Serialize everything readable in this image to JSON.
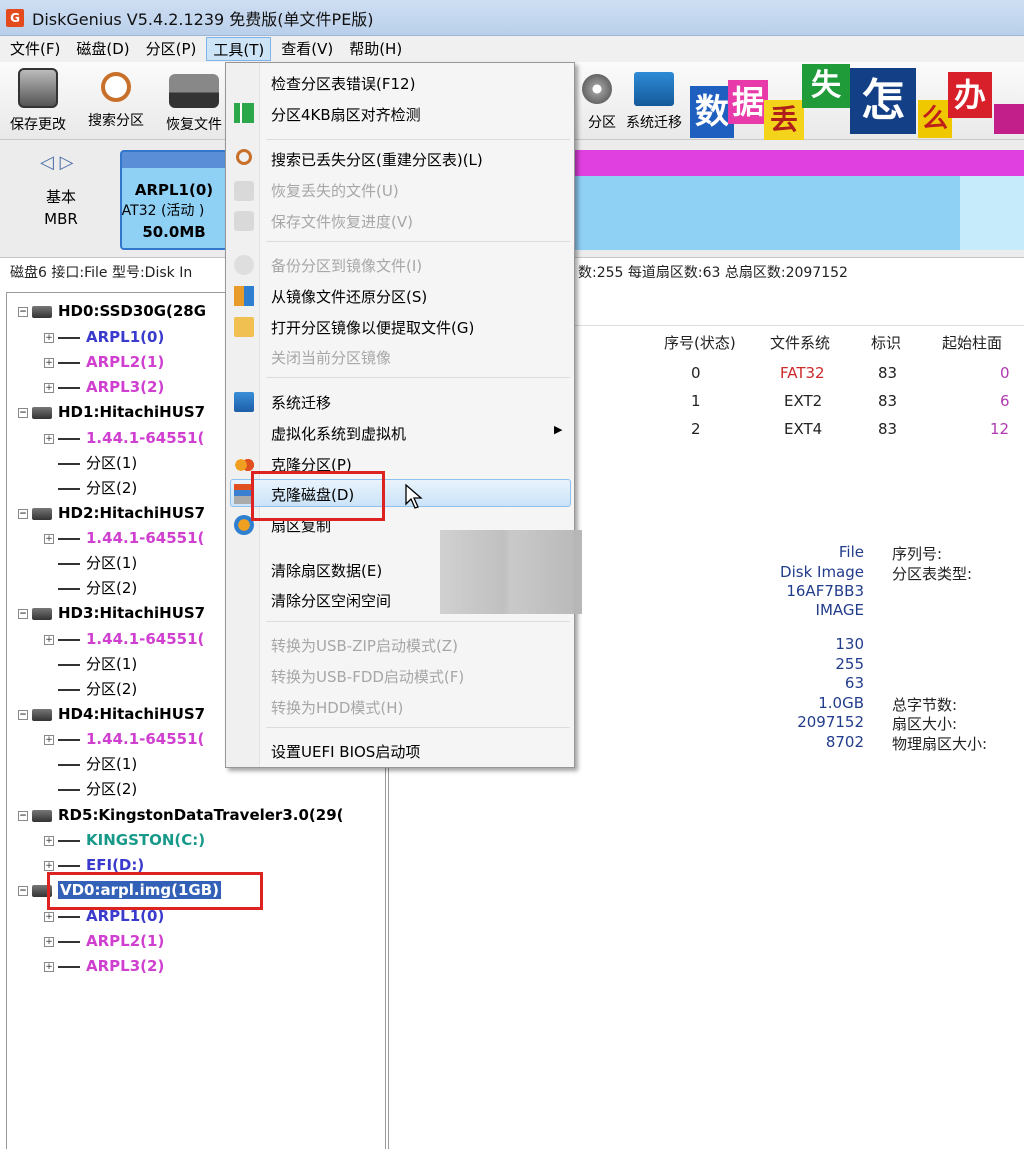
{
  "title": "DiskGenius V5.4.2.1239 免费版(单文件PE版)",
  "menubar": [
    "文件(F)",
    "磁盘(D)",
    "分区(P)",
    "工具(T)",
    "查看(V)",
    "帮助(H)"
  ],
  "toolbar": {
    "save": "保存更改",
    "search": "搜索分区",
    "recover": "恢复文件",
    "partition": "分区",
    "migrate": "系统迁移"
  },
  "banner": [
    "数",
    "据",
    "丢",
    "失",
    "怎",
    "么",
    "办"
  ],
  "disk_map": {
    "type1": "基本",
    "type2": "MBR",
    "part_name": "ARPL1(0)",
    "part_fs": "AT32 (活动 )",
    "part_size": "50.0MB"
  },
  "disk_info_left": "磁盘6 接口:File  型号:Disk In",
  "disk_info_right": "数:255  每道扇区数:63  总扇区数:2097152",
  "tree": {
    "hd0": "HD0:SSD30G(28G",
    "hd0_parts": [
      "ARPL1(0)",
      "ARPL2(1)",
      "ARPL3(2)"
    ],
    "hd1": "HD1:HitachiHUS7",
    "hd_part_a": "1.44.1-64551(",
    "part1": "分区(1)",
    "part2": "分区(2)",
    "hd2": "HD2:HitachiHUS7",
    "hd3": "HD3:HitachiHUS7",
    "hd4": "HD4:HitachiHUS7",
    "rd5": "RD5:KingstonDataTraveler3.0(29(",
    "rd5_parts": [
      "KINGSTON(C:)",
      "EFI(D:)"
    ],
    "vd0": "VD0:arpl.img(1GB)",
    "vd0_parts": [
      "ARPL1(0)",
      "ARPL2(1)",
      "ARPL3(2)"
    ]
  },
  "table": {
    "headers": [
      "序号(状态)",
      "文件系统",
      "标识",
      "起始柱面"
    ],
    "rows": [
      [
        "0",
        "FAT32",
        "83",
        "0"
      ],
      [
        "1",
        "EXT2",
        "83",
        "6"
      ],
      [
        "2",
        "EXT4",
        "83",
        "12"
      ]
    ]
  },
  "props": {
    "type_val": "File",
    "model_val": "Disk Image",
    "serial_val": "16AF7BB3",
    "img_val": "IMAGE",
    "serial_lbl": "序列号:",
    "pt_lbl": "分区表类型:",
    "cyl": "130",
    "heads": "255",
    "sectors": "63",
    "capacity": "1.0GB",
    "total_sectors": "2097152",
    "extra": "8702",
    "total_bytes_lbl": "总字节数:",
    "sector_size_lbl": "扇区大小:",
    "phys_sector_lbl": "物理扇区大小:"
  },
  "tools_menu": {
    "check": "检查分区表错误(F12)",
    "align": "分区4KB扇区对齐检测",
    "search_lost": "搜索已丢失分区(重建分区表)(L)",
    "recover_lost": "恢复丢失的文件(U)",
    "save_progress": "保存文件恢复进度(V)",
    "backup_img": "备份分区到镜像文件(I)",
    "restore_img": "从镜像文件还原分区(S)",
    "open_img": "打开分区镜像以便提取文件(G)",
    "close_img": "关闭当前分区镜像",
    "migrate": "系统迁移",
    "virtualize": "虚拟化系统到虚拟机",
    "clone_part": "克隆分区(P)",
    "clone_disk": "克隆磁盘(D)",
    "sector_copy": "扇区复制",
    "clear_sector": "清除扇区数据(E)",
    "clear_free": "清除分区空闲空间",
    "usb_zip": "转换为USB-ZIP启动模式(Z)",
    "usb_fdd": "转换为USB-FDD启动模式(F)",
    "hdd": "转换为HDD模式(H)",
    "uefi": "设置UEFI BIOS启动项"
  },
  "colors": {
    "accent": "#3461b8",
    "highlight_red": "#dd2222",
    "fat32": "#cc2a2a",
    "magenta": "#d040d0"
  }
}
